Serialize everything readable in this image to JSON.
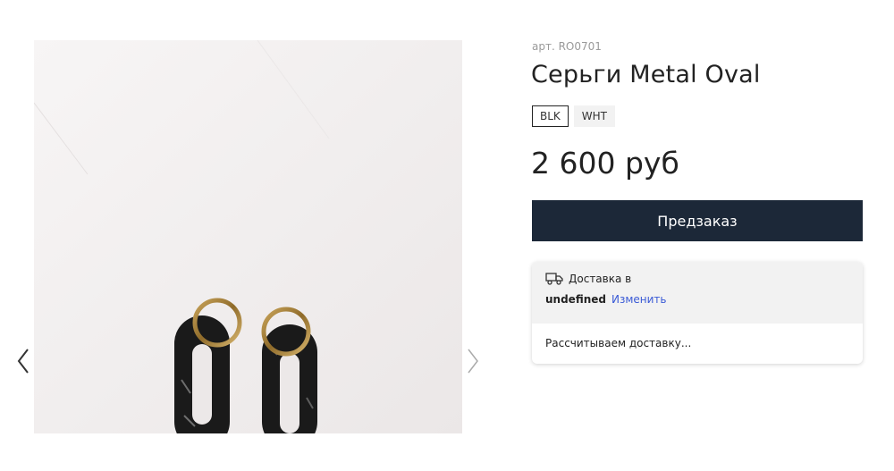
{
  "gallery": {
    "prev_icon": "chevron-left-icon",
    "next_icon": "chevron-right-icon",
    "image_alt": "Серьги Metal Oval"
  },
  "product": {
    "sku": "арт. RO0701",
    "title": "Серьги Metal Oval",
    "swatches": [
      {
        "label": "BLK",
        "selected": true
      },
      {
        "label": "WHT",
        "selected": false
      }
    ],
    "price": "2 600 руб",
    "preorder_label": "Предзаказ"
  },
  "delivery": {
    "icon": "truck-icon",
    "label": "Доставка в",
    "city": "undefined",
    "change_label": "Изменить",
    "status": "Рассчитываем доставку..."
  },
  "colors": {
    "button_bg": "#1c2838",
    "link": "#3b5bd6"
  }
}
